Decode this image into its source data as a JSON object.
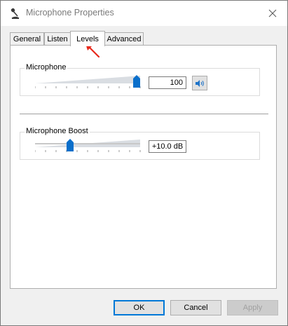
{
  "window": {
    "title": "Microphone Properties"
  },
  "tabs": [
    {
      "label": "General",
      "active": false
    },
    {
      "label": "Listen",
      "active": false
    },
    {
      "label": "Levels",
      "active": true
    },
    {
      "label": "Advanced",
      "active": false
    }
  ],
  "levels": {
    "microphone": {
      "label": "Microphone",
      "value": "100",
      "slider_level": 1.0
    },
    "boost": {
      "label": "Microphone Boost",
      "value": "+10.0 dB",
      "slider_level": 0.33
    }
  },
  "buttons": {
    "ok": "OK",
    "cancel": "Cancel",
    "apply": "Apply"
  },
  "colors": {
    "accent": "#0078d7",
    "annotation_arrow": "#e8291c"
  },
  "icons": {
    "app": "microphone-icon",
    "close": "close-icon",
    "speaker": "speaker-volume-icon"
  }
}
